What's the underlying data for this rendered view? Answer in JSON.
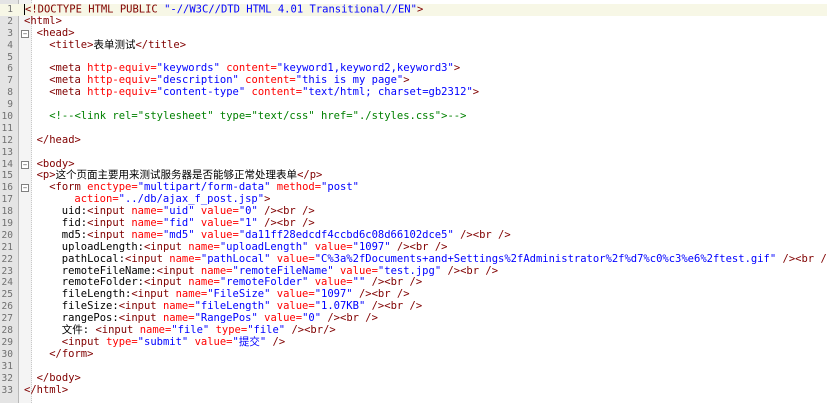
{
  "editor": {
    "lines": [
      {
        "num": "1",
        "indent": 0,
        "fold": "",
        "tokens": [
          {
            "t": "tg",
            "v": "<!DOCTYPE HTML PUBLIC "
          },
          {
            "t": "av",
            "v": "\"-//W3C//DTD HTML 4.01 Transitional//EN\""
          },
          {
            "t": "tg",
            "v": ">"
          }
        ]
      },
      {
        "num": "2",
        "indent": 0,
        "fold": "",
        "tokens": [
          {
            "t": "tg",
            "v": "<html>"
          }
        ]
      },
      {
        "num": "3",
        "indent": 2,
        "fold": "−",
        "tokens": [
          {
            "t": "tg",
            "v": "<head>"
          }
        ]
      },
      {
        "num": "4",
        "indent": 4,
        "fold": "",
        "tokens": [
          {
            "t": "tg",
            "v": "<title>"
          },
          {
            "t": "tx",
            "v": "表单测试"
          },
          {
            "t": "tg",
            "v": "</title>"
          }
        ]
      },
      {
        "num": "5",
        "indent": 0,
        "fold": "",
        "tokens": []
      },
      {
        "num": "6",
        "indent": 4,
        "fold": "",
        "tokens": [
          {
            "t": "tg",
            "v": "<meta "
          },
          {
            "t": "an",
            "v": "http-equiv="
          },
          {
            "t": "av",
            "v": "\"keywords\""
          },
          {
            "t": "an",
            "v": " content="
          },
          {
            "t": "av",
            "v": "\"keyword1,keyword2,keyword3\""
          },
          {
            "t": "tg",
            "v": ">"
          }
        ]
      },
      {
        "num": "7",
        "indent": 4,
        "fold": "",
        "tokens": [
          {
            "t": "tg",
            "v": "<meta "
          },
          {
            "t": "an",
            "v": "http-equiv="
          },
          {
            "t": "av",
            "v": "\"description\""
          },
          {
            "t": "an",
            "v": " content="
          },
          {
            "t": "av",
            "v": "\"this is my page\""
          },
          {
            "t": "tg",
            "v": ">"
          }
        ]
      },
      {
        "num": "8",
        "indent": 4,
        "fold": "",
        "tokens": [
          {
            "t": "tg",
            "v": "<meta "
          },
          {
            "t": "an",
            "v": "http-equiv="
          },
          {
            "t": "av",
            "v": "\"content-type\""
          },
          {
            "t": "an",
            "v": " content="
          },
          {
            "t": "av",
            "v": "\"text/html; charset=gb2312\""
          },
          {
            "t": "tg",
            "v": ">"
          }
        ]
      },
      {
        "num": "9",
        "indent": 0,
        "fold": "",
        "tokens": []
      },
      {
        "num": "10",
        "indent": 4,
        "fold": "",
        "tokens": [
          {
            "t": "cm",
            "v": "<!--<link rel=\"stylesheet\" type=\"text/css\" href=\"./styles.css\">-->"
          }
        ]
      },
      {
        "num": "11",
        "indent": 0,
        "fold": "",
        "tokens": []
      },
      {
        "num": "12",
        "indent": 2,
        "fold": "",
        "tokens": [
          {
            "t": "tg",
            "v": "</head>"
          }
        ]
      },
      {
        "num": "13",
        "indent": 0,
        "fold": "",
        "tokens": []
      },
      {
        "num": "14",
        "indent": 2,
        "fold": "−",
        "tokens": [
          {
            "t": "tg",
            "v": "<body>"
          }
        ]
      },
      {
        "num": "15",
        "indent": 2,
        "fold": "",
        "tokens": [
          {
            "t": "tg",
            "v": "<p>"
          },
          {
            "t": "tx",
            "v": "这个页面主要用来测试服务器是否能够正常处理表单"
          },
          {
            "t": "tg",
            "v": "</p>"
          }
        ]
      },
      {
        "num": "16",
        "indent": 4,
        "fold": "−",
        "tokens": [
          {
            "t": "tg",
            "v": "<form "
          },
          {
            "t": "an",
            "v": "enctype="
          },
          {
            "t": "av",
            "v": "\"multipart/form-data\""
          },
          {
            "t": "an",
            "v": " method="
          },
          {
            "t": "av",
            "v": "\"post\""
          }
        ]
      },
      {
        "num": "17",
        "indent": 8,
        "fold": "",
        "tokens": [
          {
            "t": "an",
            "v": "action="
          },
          {
            "t": "av",
            "v": "\"../db/ajax_f_post.jsp\""
          },
          {
            "t": "tg",
            "v": ">"
          }
        ]
      },
      {
        "num": "18",
        "indent": 6,
        "fold": "",
        "tokens": [
          {
            "t": "tx",
            "v": "uid:"
          },
          {
            "t": "tg",
            "v": "<input "
          },
          {
            "t": "an",
            "v": "name="
          },
          {
            "t": "av",
            "v": "\"uid\""
          },
          {
            "t": "an",
            "v": " value="
          },
          {
            "t": "av",
            "v": "\"0\""
          },
          {
            "t": "tg",
            "v": " /><br />"
          }
        ]
      },
      {
        "num": "19",
        "indent": 6,
        "fold": "",
        "tokens": [
          {
            "t": "tx",
            "v": "fid:"
          },
          {
            "t": "tg",
            "v": "<input "
          },
          {
            "t": "an",
            "v": "name="
          },
          {
            "t": "av",
            "v": "\"fid\""
          },
          {
            "t": "an",
            "v": " value="
          },
          {
            "t": "av",
            "v": "\"1\""
          },
          {
            "t": "tg",
            "v": " /><br />"
          }
        ]
      },
      {
        "num": "20",
        "indent": 6,
        "fold": "",
        "tokens": [
          {
            "t": "tx",
            "v": "md5:"
          },
          {
            "t": "tg",
            "v": "<input "
          },
          {
            "t": "an",
            "v": "name="
          },
          {
            "t": "av",
            "v": "\"md5\""
          },
          {
            "t": "an",
            "v": " value="
          },
          {
            "t": "av",
            "v": "\"da11ff28edcdf4ccbd6c08d66102dce5\""
          },
          {
            "t": "tg",
            "v": " /><br />"
          }
        ]
      },
      {
        "num": "21",
        "indent": 6,
        "fold": "",
        "tokens": [
          {
            "t": "tx",
            "v": "uploadLength:"
          },
          {
            "t": "tg",
            "v": "<input "
          },
          {
            "t": "an",
            "v": "name="
          },
          {
            "t": "av",
            "v": "\"uploadLength\""
          },
          {
            "t": "an",
            "v": " value="
          },
          {
            "t": "av",
            "v": "\"1097\""
          },
          {
            "t": "tg",
            "v": " /><br />"
          }
        ]
      },
      {
        "num": "22",
        "indent": 6,
        "fold": "",
        "tokens": [
          {
            "t": "tx",
            "v": "pathLocal:"
          },
          {
            "t": "tg",
            "v": "<input "
          },
          {
            "t": "an",
            "v": "name="
          },
          {
            "t": "av",
            "v": "\"pathLocal\""
          },
          {
            "t": "an",
            "v": " value="
          },
          {
            "t": "av",
            "v": "\"C%3a%2fDocuments+and+Settings%2fAdministrator%2f%d7%c0%c3%e6%2ftest.gif\""
          },
          {
            "t": "tg",
            "v": " /><br />"
          }
        ]
      },
      {
        "num": "23",
        "indent": 6,
        "fold": "",
        "tokens": [
          {
            "t": "tx",
            "v": "remoteFileName:"
          },
          {
            "t": "tg",
            "v": "<input "
          },
          {
            "t": "an",
            "v": "name="
          },
          {
            "t": "av",
            "v": "\"remoteFileName\""
          },
          {
            "t": "an",
            "v": " value="
          },
          {
            "t": "av",
            "v": "\"test.jpg\""
          },
          {
            "t": "tg",
            "v": " /><br />"
          }
        ]
      },
      {
        "num": "24",
        "indent": 6,
        "fold": "",
        "tokens": [
          {
            "t": "tx",
            "v": "remoteFolder:"
          },
          {
            "t": "tg",
            "v": "<input "
          },
          {
            "t": "an",
            "v": "name="
          },
          {
            "t": "av",
            "v": "\"remoteFolder\""
          },
          {
            "t": "an",
            "v": " value="
          },
          {
            "t": "av",
            "v": "\"\""
          },
          {
            "t": "tg",
            "v": " /><br />"
          }
        ]
      },
      {
        "num": "25",
        "indent": 6,
        "fold": "",
        "tokens": [
          {
            "t": "tx",
            "v": "fileLength:"
          },
          {
            "t": "tg",
            "v": "<input "
          },
          {
            "t": "an",
            "v": "name="
          },
          {
            "t": "av",
            "v": "\"FileSize\""
          },
          {
            "t": "an",
            "v": " value="
          },
          {
            "t": "av",
            "v": "\"1097\""
          },
          {
            "t": "tg",
            "v": " /><br />"
          }
        ]
      },
      {
        "num": "26",
        "indent": 6,
        "fold": "",
        "tokens": [
          {
            "t": "tx",
            "v": "fileSize:"
          },
          {
            "t": "tg",
            "v": "<input "
          },
          {
            "t": "an",
            "v": "name="
          },
          {
            "t": "av",
            "v": "\"fileLength\""
          },
          {
            "t": "an",
            "v": " value="
          },
          {
            "t": "av",
            "v": "\"1.07KB\""
          },
          {
            "t": "tg",
            "v": " /><br />"
          }
        ]
      },
      {
        "num": "27",
        "indent": 6,
        "fold": "",
        "tokens": [
          {
            "t": "tx",
            "v": "rangePos:"
          },
          {
            "t": "tg",
            "v": "<input "
          },
          {
            "t": "an",
            "v": "name="
          },
          {
            "t": "av",
            "v": "\"RangePos\""
          },
          {
            "t": "an",
            "v": " value="
          },
          {
            "t": "av",
            "v": "\"0\""
          },
          {
            "t": "tg",
            "v": " /><br />"
          }
        ]
      },
      {
        "num": "28",
        "indent": 6,
        "fold": "",
        "tokens": [
          {
            "t": "tx",
            "v": "文件: "
          },
          {
            "t": "tg",
            "v": "<input "
          },
          {
            "t": "an",
            "v": "name="
          },
          {
            "t": "av",
            "v": "\"file\""
          },
          {
            "t": "an",
            "v": " type="
          },
          {
            "t": "av",
            "v": "\"file\""
          },
          {
            "t": "tg",
            "v": " /><br/>"
          }
        ]
      },
      {
        "num": "29",
        "indent": 6,
        "fold": "",
        "tokens": [
          {
            "t": "tg",
            "v": "<input "
          },
          {
            "t": "an",
            "v": "type="
          },
          {
            "t": "av",
            "v": "\"submit\""
          },
          {
            "t": "an",
            "v": " value="
          },
          {
            "t": "av",
            "v": "\"提交\""
          },
          {
            "t": "tg",
            "v": " />"
          }
        ]
      },
      {
        "num": "30",
        "indent": 4,
        "fold": "",
        "tokens": [
          {
            "t": "tg",
            "v": "</form>"
          }
        ]
      },
      {
        "num": "31",
        "indent": 0,
        "fold": "",
        "tokens": []
      },
      {
        "num": "32",
        "indent": 2,
        "fold": "",
        "tokens": [
          {
            "t": "tg",
            "v": "</body>"
          }
        ]
      },
      {
        "num": "33",
        "indent": 0,
        "fold": "",
        "tokens": [
          {
            "t": "tg",
            "v": "</html>"
          }
        ]
      }
    ]
  }
}
